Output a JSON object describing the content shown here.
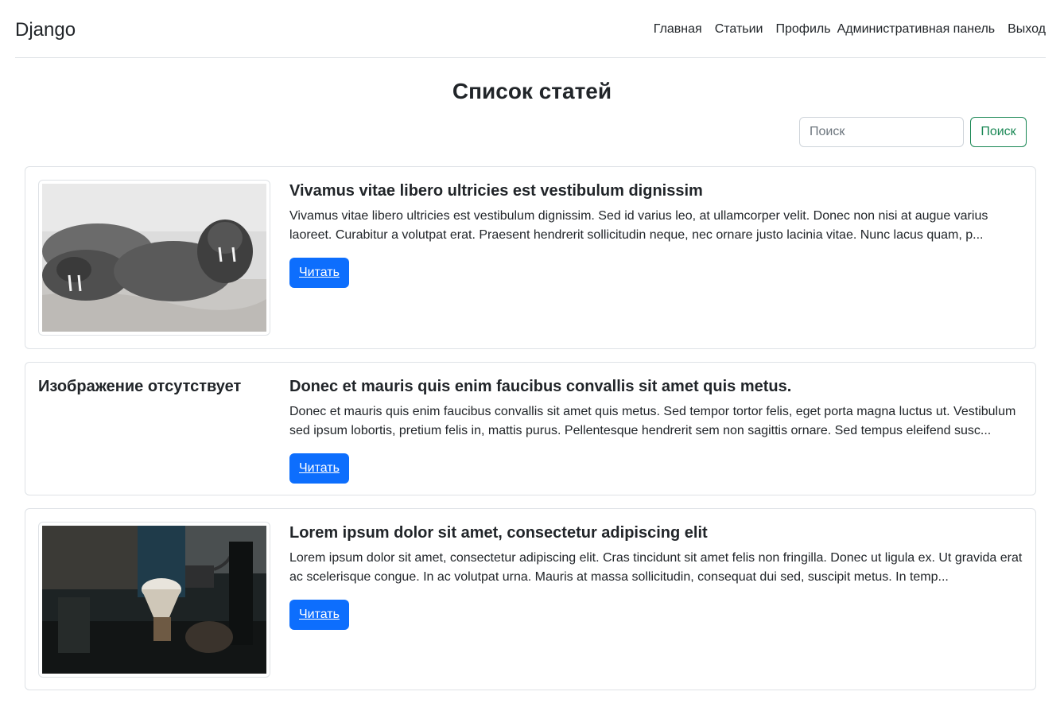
{
  "navbar": {
    "brand": "Django",
    "links": [
      "Главная",
      "Статьии",
      "Профиль",
      "Административная панель",
      "Выход"
    ]
  },
  "page_title": "Список статей",
  "search": {
    "placeholder": "Поиск",
    "button_label": "Поиск"
  },
  "articles": [
    {
      "title": "Vivamus vitae libero ultricies est vestibulum dignissim",
      "excerpt": "Vivamus vitae libero ultricies est vestibulum dignissim. Sed id varius leo, at ullamcorper velit. Donec non nisi at augue varius laoreet. Curabitur a volutpat erat. Praesent hendrerit sollicitudin neque, nec ornare justo lacinia vitae. Nunc lacus quam, p...",
      "button_label": "Читать"
    },
    {
      "no_image_label": "Изображение отсутствует",
      "title": "Donec et mauris quis enim faucibus convallis sit amet quis metus.",
      "excerpt": "Donec et mauris quis enim faucibus convallis sit amet quis metus. Sed tempor tortor felis, eget porta magna luctus ut. Vestibulum sed ipsum lobortis, pretium felis in, mattis purus. Pellentesque hendrerit sem non sagittis ornare. Sed tempus eleifend susc...",
      "button_label": "Читать"
    },
    {
      "title": "Lorem ipsum dolor sit amet, consectetur adipiscing elit",
      "excerpt": "Lorem ipsum dolor sit amet, consectetur adipiscing elit. Cras tincidunt sit amet felis non fringilla. Donec ut ligula ex. Ut gravida erat ac scelerisque congue. In ac volutpat urna. Mauris at massa sollicitudin, consequat dui sed, suscipit metus. In temp...",
      "button_label": "Читать"
    }
  ],
  "colors": {
    "primary": "#0d6efd",
    "success": "#198754",
    "border": "#dee2e6",
    "text": "#212529"
  }
}
